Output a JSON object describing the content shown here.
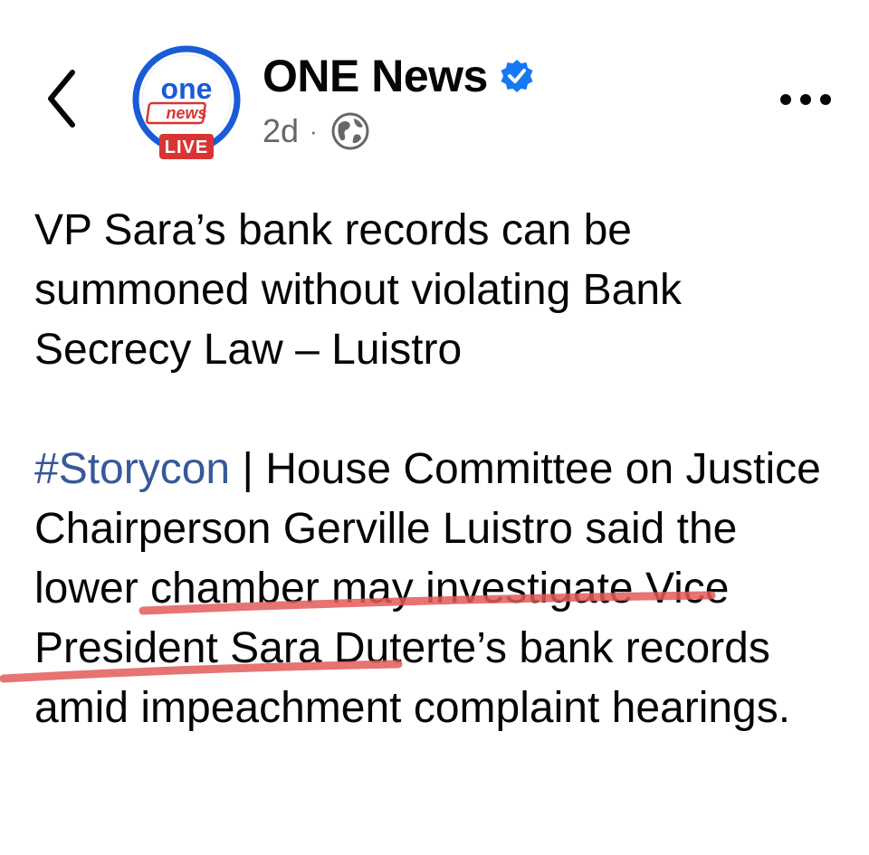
{
  "header": {
    "page_name": "ONE News",
    "timestamp": "2d",
    "separator": "·",
    "icons": {
      "back": "chevron-left-icon",
      "verified": "verified-badge-icon",
      "audience": "globe-icon",
      "more": "more-horizontal-icon"
    },
    "avatar": {
      "logo_top": "one",
      "logo_bottom": "news",
      "badge": "LIVE"
    }
  },
  "post": {
    "headline": "VP Sara’s bank records can be summoned without violating Bank Secrecy Law – Luistro",
    "hashtag": "#Storycon",
    "body_rest": " | House Committee on Justice Chairperson Gerville Luistro said the lower chamber may investigate Vice President Sara Duterte’s bank records amid impeachment complaint hearings."
  },
  "colors": {
    "text": "#050505",
    "muted": "#65676b",
    "hashtag": "#385898",
    "verified": "#1877f2",
    "brand_blue": "#1a5bd6",
    "live_red": "#d93434",
    "annotation": "#e35a5a"
  }
}
